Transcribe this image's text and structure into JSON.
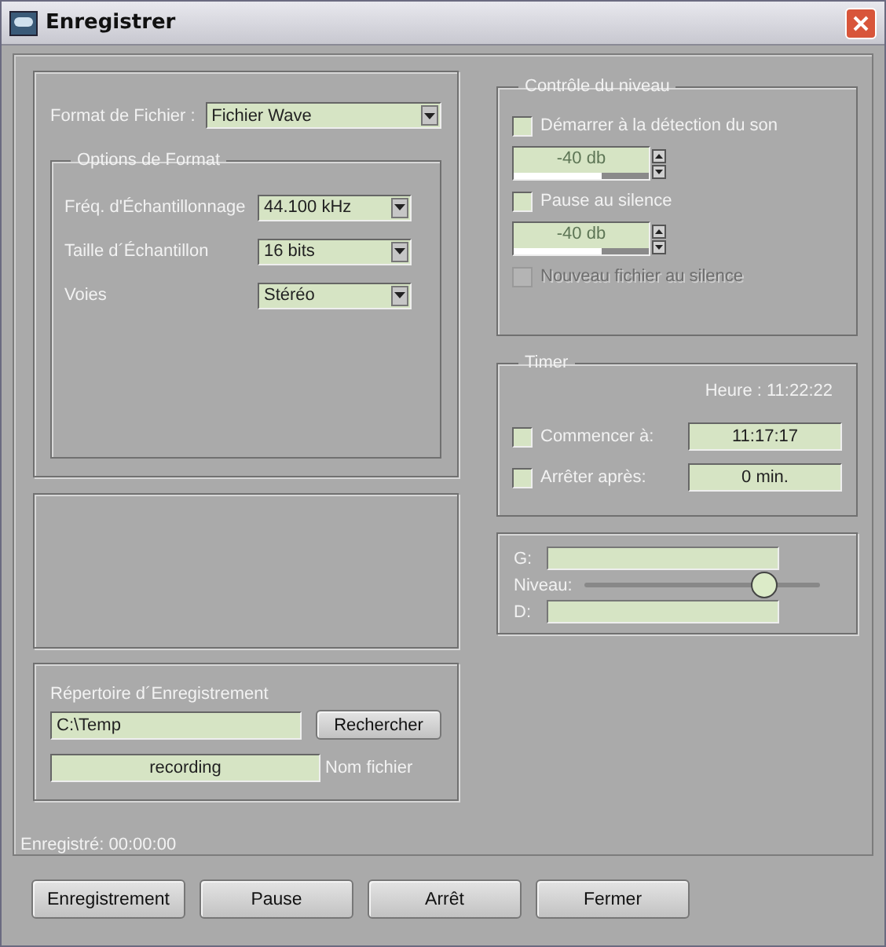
{
  "window": {
    "title": "Enregistrer"
  },
  "file_format": {
    "label": "Format de Fichier :",
    "value": "Fichier Wave"
  },
  "format_options": {
    "title": "Options de Format",
    "rows": [
      {
        "label": "Fréq. d'Échantillonnage",
        "value": "44.100 kHz"
      },
      {
        "label": "Taille d´Échantillon",
        "value": "16 bits"
      },
      {
        "label": "Voies",
        "value": "Stéréo"
      }
    ]
  },
  "level_control": {
    "title": "Contrôle du niveau",
    "items": [
      {
        "kind": "checkbox",
        "label": "Démarrer à la détection du son",
        "checked": false,
        "disabled": false
      },
      {
        "kind": "spin",
        "value": "-40 db",
        "level": 0.65
      },
      {
        "kind": "checkbox",
        "label": "Pause au silence",
        "checked": false,
        "disabled": false
      },
      {
        "kind": "spin",
        "value": "-40 db",
        "level": 0.65
      },
      {
        "kind": "checkbox",
        "label": "Nouveau fichier au silence",
        "checked": false,
        "disabled": true
      }
    ]
  },
  "timer": {
    "title": "Timer",
    "clock": "Heure : 11:22:22",
    "rows": [
      {
        "label": "Commencer à:",
        "checked": false,
        "value": "11:17:17"
      },
      {
        "label": "Arrêter après:",
        "checked": false,
        "value": "0 min."
      }
    ]
  },
  "meters": {
    "channels": [
      {
        "label": "G:",
        "level": 0
      },
      {
        "label": "D:",
        "level": 0
      }
    ],
    "level_label": "Niveau:",
    "slider": {
      "level": 0.76
    }
  },
  "directory": {
    "title": "Répertoire d´Enregistrement",
    "path": "C:\\Temp",
    "browse_button": "Rechercher",
    "filename": "recording",
    "filename_label": "Nom fichier"
  },
  "status": "Enregistré: 00:00:00",
  "buttons": [
    "Enregistrement",
    "Pause",
    "Arrêt",
    "Fermer"
  ]
}
